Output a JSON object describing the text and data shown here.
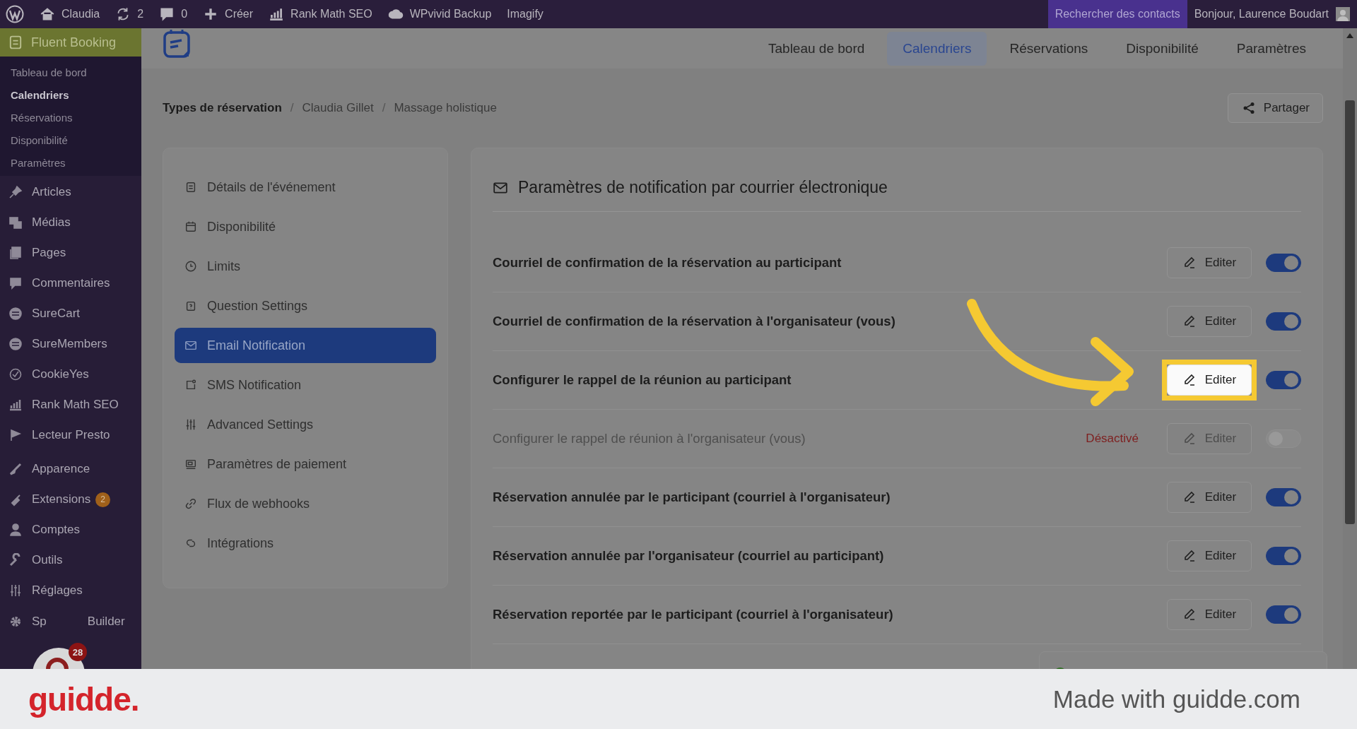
{
  "admin_bar": {
    "items": [
      {
        "label": "Claudia"
      },
      {
        "label": "2"
      },
      {
        "label": "0"
      },
      {
        "label": "Créer"
      },
      {
        "label": "Rank Math SEO"
      },
      {
        "label": "WPvivid Backup"
      },
      {
        "label": "Imagify"
      }
    ],
    "search_contacts": "Rechercher des contacts",
    "greeting": "Bonjour, Laurence Boudart"
  },
  "sidebar": {
    "plugin": "Fluent Booking",
    "submenu": [
      {
        "label": "Tableau de bord",
        "selected": false
      },
      {
        "label": "Calendriers",
        "selected": true
      },
      {
        "label": "Réservations",
        "selected": false
      },
      {
        "label": "Disponibilité",
        "selected": false
      },
      {
        "label": "Paramètres",
        "selected": false
      }
    ],
    "menu_groups": [
      [
        {
          "label": "Articles"
        },
        {
          "label": "Médias"
        },
        {
          "label": "Pages"
        },
        {
          "label": "Commentaires"
        },
        {
          "label": "SureCart"
        },
        {
          "label": "SureMembers"
        },
        {
          "label": "CookieYes"
        },
        {
          "label": "Rank Math SEO"
        },
        {
          "label": "Lecteur Presto"
        }
      ],
      [
        {
          "label": "Apparence"
        },
        {
          "label": "Extensions",
          "badge": "2"
        },
        {
          "label": "Comptes"
        },
        {
          "label": "Outils"
        },
        {
          "label": "Réglages"
        }
      ]
    ],
    "last_item": {
      "label_start": "Sp",
      "label_end": "Builder"
    }
  },
  "chat_widget": {
    "badge": "28"
  },
  "top_nav": {
    "tabs": [
      {
        "label": "Tableau de bord",
        "selected": false
      },
      {
        "label": "Calendriers",
        "selected": true
      },
      {
        "label": "Réservations",
        "selected": false
      },
      {
        "label": "Disponibilité",
        "selected": false
      },
      {
        "label": "Paramètres",
        "selected": false
      }
    ]
  },
  "breadcrumb": {
    "items": [
      "Types de réservation",
      "Claudia Gillet",
      "Massage holistique"
    ],
    "separator": "/"
  },
  "share_button": "Partager",
  "settings_menu": [
    {
      "label": "Détails de l'événement",
      "selected": false
    },
    {
      "label": "Disponibilité",
      "selected": false
    },
    {
      "label": "Limits",
      "selected": false
    },
    {
      "label": "Question Settings",
      "selected": false
    },
    {
      "label": "Email Notification",
      "selected": true
    },
    {
      "label": "SMS Notification",
      "selected": false
    },
    {
      "label": "Advanced Settings",
      "selected": false
    },
    {
      "label": "Paramètres de paiement",
      "selected": false
    },
    {
      "label": "Flux de webhooks",
      "selected": false
    },
    {
      "label": "Intégrations",
      "selected": false
    }
  ],
  "panel": {
    "title": "Paramètres de notification par courrier électronique",
    "rows": [
      {
        "label": "Courriel de confirmation de la réservation au participant",
        "button": "Editer",
        "enabled": true,
        "highlighted": false
      },
      {
        "label": "Courriel de confirmation de la réservation à l'organisateur (vous)",
        "button": "Editer",
        "enabled": true,
        "highlighted": false
      },
      {
        "label": "Configurer le rappel de la réunion au participant",
        "button": "Editer",
        "enabled": true,
        "highlighted": true
      },
      {
        "label": "Configurer le rappel de réunion à l'organisateur (vous)",
        "status": "Désactivé",
        "button": "Editer",
        "enabled": false,
        "highlighted": false
      },
      {
        "label": "Réservation annulée par le participant (courriel à l'organisateur)",
        "button": "Editer",
        "enabled": true,
        "highlighted": false
      },
      {
        "label": "Réservation annulée par l'organisateur (courriel au participant)",
        "button": "Editer",
        "enabled": true,
        "highlighted": false
      },
      {
        "label": "Réservation reportée par le participant (courriel à l'organisateur)",
        "button": "Editer",
        "enabled": true,
        "highlighted": false
      }
    ]
  },
  "footer": {
    "logo": "guidde.",
    "tagline": "Made with guidde.com"
  }
}
